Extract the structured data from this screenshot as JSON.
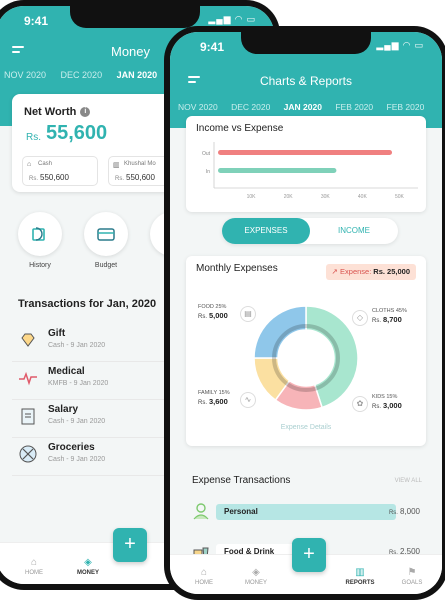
{
  "colors": {
    "accent": "#30b3b0",
    "income_bar": "#f08080",
    "expense_bar": "#7fd1b9",
    "badge_bg": "#fde1d6"
  },
  "phone1": {
    "status": {
      "time": "9:41"
    },
    "header": {
      "title": "Money"
    },
    "tabs": [
      {
        "label": "NOV 2020"
      },
      {
        "label": "DEC 2020"
      },
      {
        "label": "JAN 2020"
      }
    ],
    "net_worth": {
      "label": "Net Worth",
      "currency": "Rs.",
      "value": "55,600",
      "accounts": [
        {
          "name": "Cash",
          "currency": "Rs.",
          "amount": "550,600"
        },
        {
          "name": "Khushal Mo",
          "currency": "Rs.",
          "amount": "550,600"
        }
      ]
    },
    "quick_actions": [
      {
        "label": "History",
        "icon": "history-icon"
      },
      {
        "label": "Budget",
        "icon": "budget-icon"
      }
    ],
    "transactions": {
      "title": "Transactions for Jan, 2020",
      "items": [
        {
          "name": "Gift",
          "sub": "Cash - 9 Jan 2020",
          "icon": "gift-icon"
        },
        {
          "name": "Medical",
          "sub": "KMFB - 9 Jan 2020",
          "icon": "medical-icon"
        },
        {
          "name": "Salary",
          "sub": "Cash - 9 Jan 2020",
          "icon": "salary-icon"
        },
        {
          "name": "Groceries",
          "sub": "Cash - 9 Jan 2020",
          "icon": "groceries-icon"
        }
      ]
    },
    "nav": [
      {
        "label": "HOME"
      },
      {
        "label": "MONEY"
      }
    ],
    "fab": "+"
  },
  "phone2": {
    "status": {
      "time": "9:41"
    },
    "header": {
      "title": "Charts & Reports"
    },
    "tabs": [
      {
        "label": "NOV 2020"
      },
      {
        "label": "DEC 2020"
      },
      {
        "label": "JAN 2020"
      },
      {
        "label": "FEB 2020"
      },
      {
        "label": "FEB 2020"
      }
    ],
    "income_vs_expense": {
      "title": "Income vs Expense",
      "rows": [
        {
          "label": "Out",
          "value": 48000
        },
        {
          "label": "In",
          "value": 33000
        }
      ],
      "ticks": [
        "10K",
        "20K",
        "30K",
        "40K",
        "50K"
      ],
      "xlim": [
        0,
        55000
      ]
    },
    "toggle": {
      "expenses": "EXPENSES",
      "income": "INCOME"
    },
    "monthly_expenses": {
      "title": "Monthly Expenses",
      "badge_label": "Expense:",
      "badge_value": "Rs. 25,000",
      "categories": [
        {
          "label": "FOOD 25%",
          "currency": "Rs.",
          "amount": "5,000",
          "percent": 25,
          "color": "#8fc7ea"
        },
        {
          "label": "CLOTHS 45%",
          "currency": "Rs.",
          "amount": "8,700",
          "percent": 45,
          "color": "#a8e6cf"
        },
        {
          "label": "KIDS 15%",
          "currency": "Rs.",
          "amount": "3,000",
          "percent": 15,
          "color": "#f7b4b8"
        },
        {
          "label": "FAMILY 15%",
          "currency": "Rs.",
          "amount": "3,600",
          "percent": 15,
          "color": "#fbe0a1"
        }
      ],
      "details_link": "Expense Details"
    },
    "expense_transactions": {
      "title": "Expense Transactions",
      "view_all": "VIEW ALL",
      "rows": [
        {
          "name": "Personal",
          "currency": "Rs.",
          "amount": "8,000",
          "fill": 0.92
        },
        {
          "name": "Food & Drink",
          "currency": "Rs.",
          "amount": "2,500",
          "fill": 0.45
        }
      ]
    },
    "nav": [
      {
        "label": "HOME"
      },
      {
        "label": "MONEY"
      },
      {
        "label": "REPORTS"
      },
      {
        "label": "GOALS"
      }
    ],
    "fab": "+"
  }
}
